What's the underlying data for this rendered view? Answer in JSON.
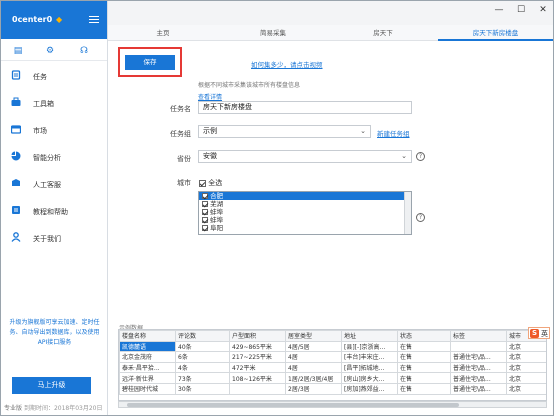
{
  "app": {
    "logo": "0center0",
    "brand_color": "#1976d6"
  },
  "sidebar": {
    "nav": [
      {
        "label": "任务",
        "icon": "task-icon"
      },
      {
        "label": "工具箱",
        "icon": "toolbox-icon"
      },
      {
        "label": "市场",
        "icon": "market-icon"
      },
      {
        "label": "智能分析",
        "icon": "analysis-icon"
      },
      {
        "label": "人工客服",
        "icon": "support-icon"
      },
      {
        "label": "教程和帮助",
        "icon": "tutorial-icon"
      },
      {
        "label": "关于我们",
        "icon": "about-icon"
      }
    ],
    "upgrade_text": "升级为旗舰版可享云加速、定时任务、自动导出到数据库，以及使用API接口服务",
    "upgrade_button": "马上升级",
    "footer_edition": "专业版",
    "footer_expiry": "到期时间：2018年03月20日"
  },
  "tabs": [
    "主页",
    "简易采集",
    "房天下",
    "房天下新房楼盘"
  ],
  "active_tab": 3,
  "toolbar": {
    "save": "保存",
    "tutorial_link": "如何集多少，请点击视频",
    "hint": "根据不同城市采集该城市所有楼盘信息",
    "detail_link": "查看详情"
  },
  "form": {
    "task_name_label": "任务名",
    "task_name_value": "房天下新房楼盘",
    "task_group_label": "任务组",
    "task_group_value": "示例",
    "new_group_link": "新建任务组",
    "province_label": "省份",
    "province_value": "安徽",
    "city_label": "城市",
    "select_all": "全选",
    "cities": [
      "合肥",
      "芜湖",
      "蚌埠",
      "蚌埠",
      "阜阳"
    ],
    "selected_city": 0
  },
  "preview": {
    "label": "示例数据",
    "columns": [
      "楼盘名称",
      "评论数",
      "户型面积",
      "居室类型",
      "地址",
      "状态",
      "标签",
      "城市"
    ],
    "rows": [
      [
        "凯德麓语",
        "40条",
        "429~865平米",
        "4居/5居",
        "[县][-]京浙高...",
        "在售",
        "",
        "北京"
      ],
      [
        "北京金茂府",
        "6条",
        "217~225平米",
        "4居",
        "[丰台]丰宋庄...",
        "在售",
        "普通住宅\\品...",
        "北京"
      ],
      [
        "泰禾·昌平拾...",
        "4条",
        "472平米",
        "4居",
        "[昌平]拓城地...",
        "在售",
        "普通住宅\\品...",
        "北京"
      ],
      [
        "远洋·新仕界",
        "73条",
        "108~126平米",
        "1居/2居/3居/4居",
        "[房山]房乡大...",
        "在售",
        "普通住宅\\品...",
        "北京"
      ],
      [
        "碧桂园时代城",
        "30条",
        "",
        "2居/3居",
        "[房加]燕郊益...",
        "在售",
        "普通住宅\\品...",
        "北京"
      ]
    ]
  },
  "ime": {
    "s": "S",
    "label": "英"
  }
}
